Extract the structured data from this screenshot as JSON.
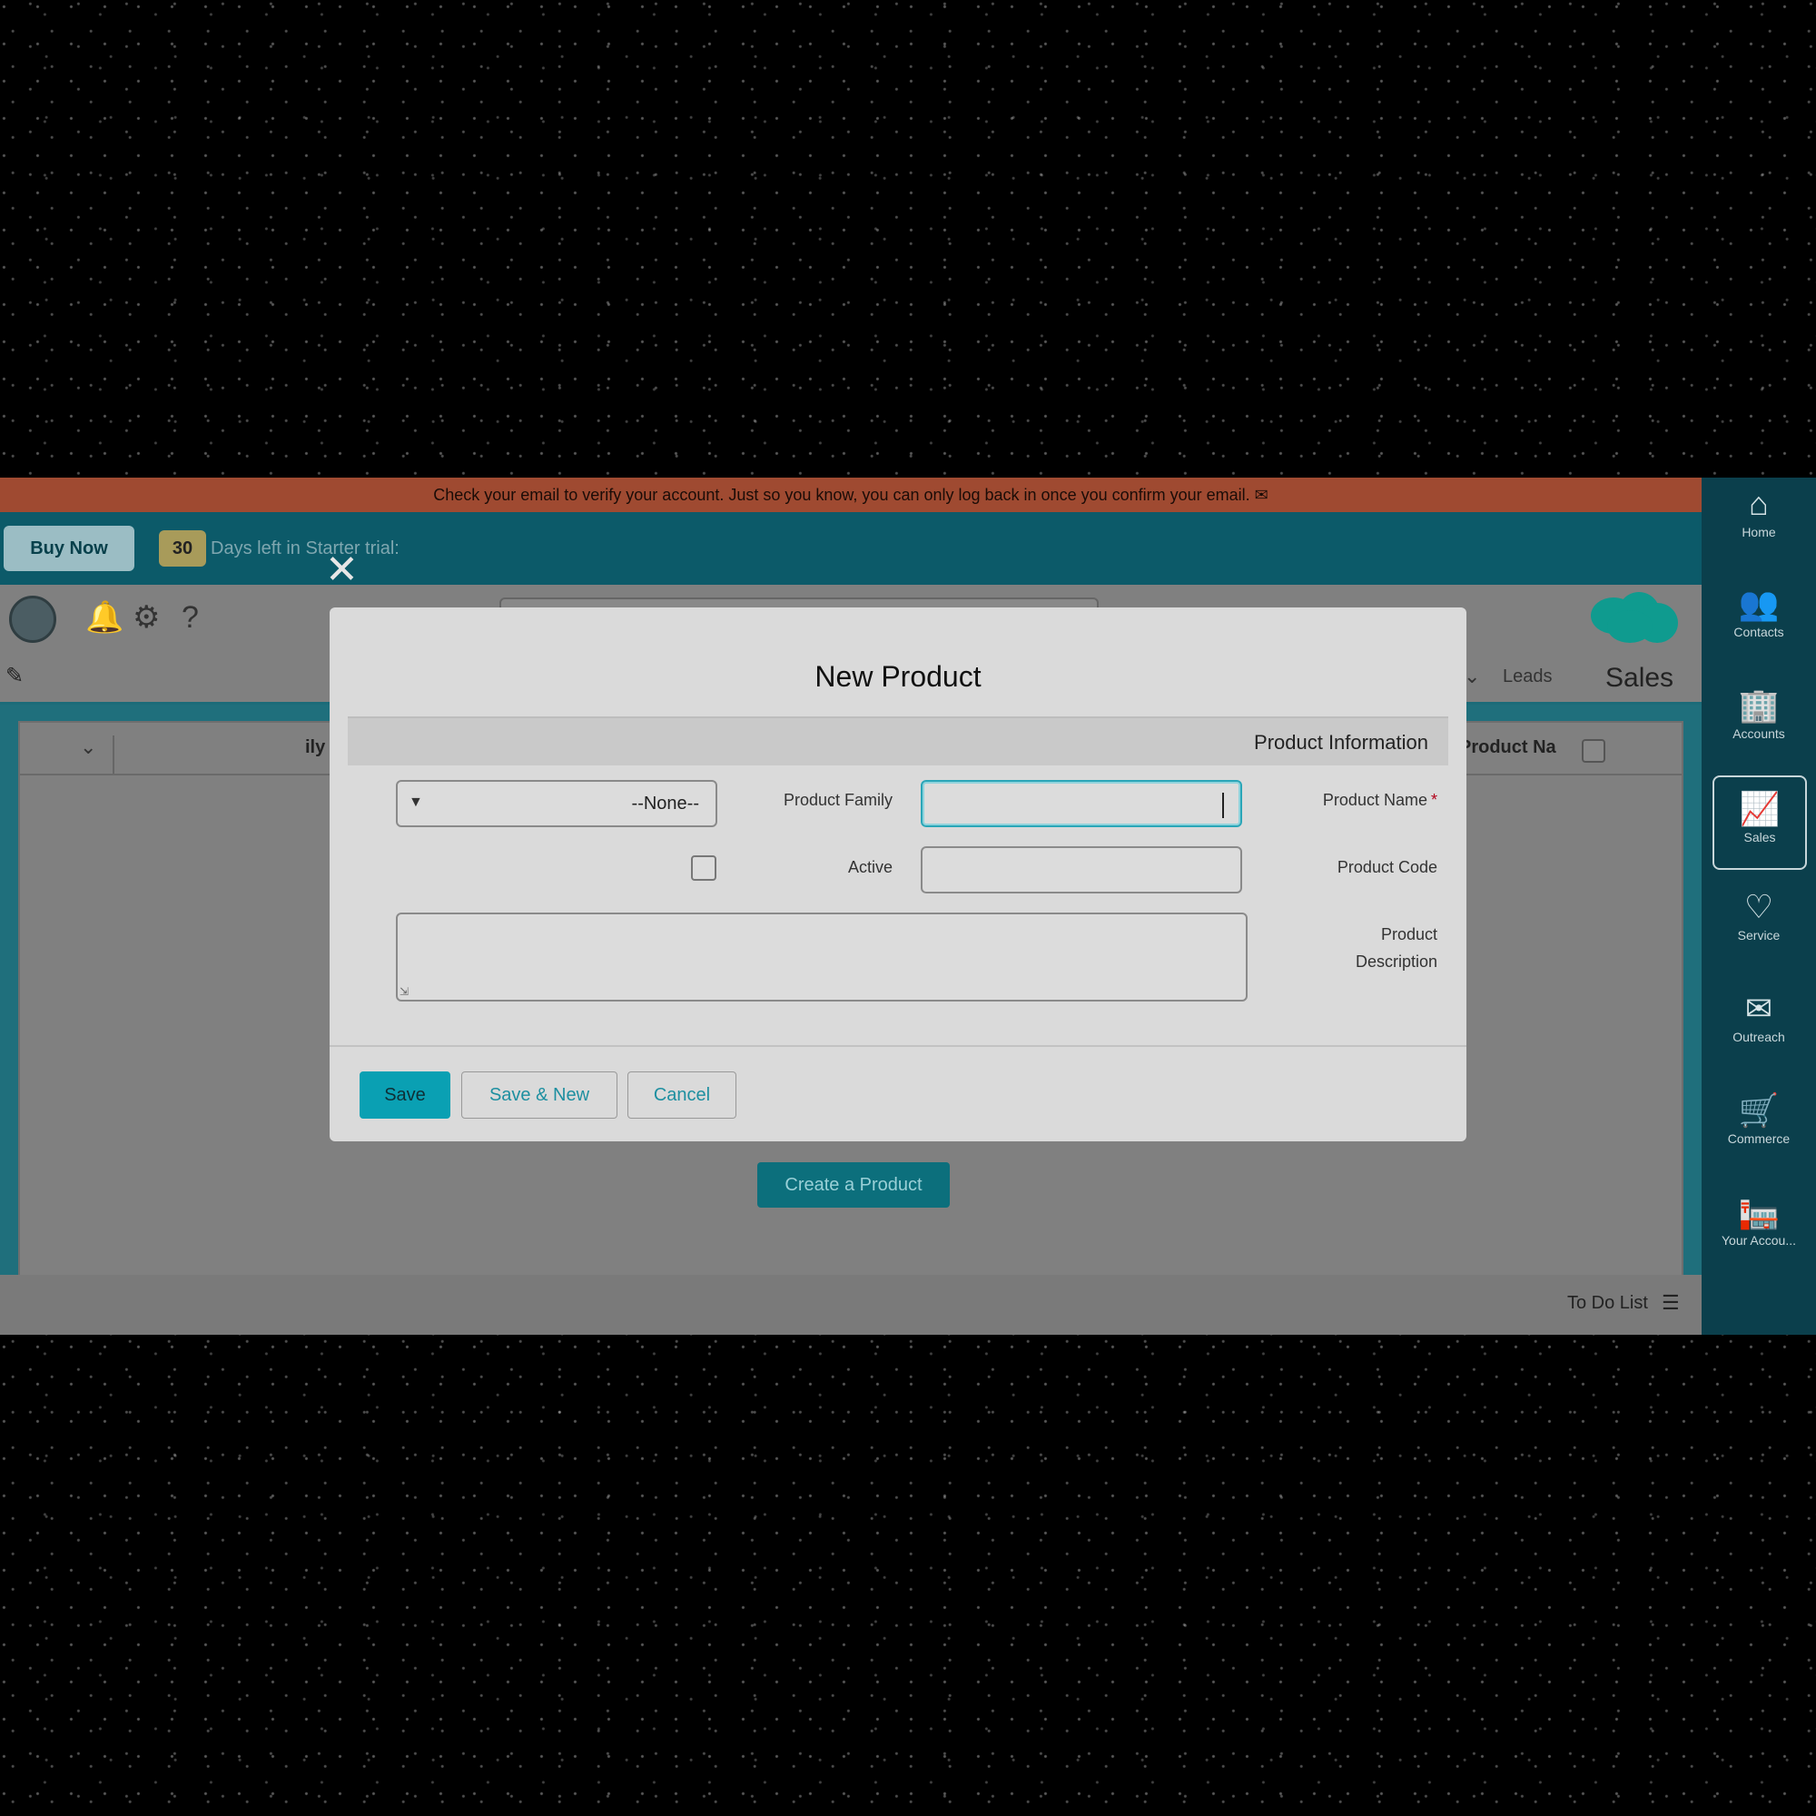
{
  "alert": {
    "icon": "envelope-icon",
    "text": "Check your email to verify your account. Just so you know, you can only log back in once you confirm your email."
  },
  "trial": {
    "label": "Days left in Starter trial:",
    "days": "30",
    "buy_label": "Buy Now"
  },
  "header": {
    "icons": [
      "help-icon",
      "gear-icon",
      "bell-icon"
    ]
  },
  "tabbar": {
    "app_title": "Sales",
    "tab_leads": "Leads"
  },
  "list": {
    "col_product_name": "Product Na",
    "col_family_fragment": "ily"
  },
  "create_product_label": "Create a Product",
  "footer": {
    "todo_label": "To Do List"
  },
  "rail": {
    "items": [
      {
        "label": "Home",
        "icon": "home-icon"
      },
      {
        "label": "Contacts",
        "icon": "contacts-icon"
      },
      {
        "label": "Accounts",
        "icon": "accounts-icon"
      },
      {
        "label": "Sales",
        "icon": "sales-icon",
        "active": true
      },
      {
        "label": "Service",
        "icon": "heart-icon"
      },
      {
        "label": "Outreach",
        "icon": "envelope-icon"
      },
      {
        "label": "Commerce",
        "icon": "cart-icon"
      },
      {
        "label": "Your Accou...",
        "icon": "building-icon"
      }
    ]
  },
  "modal": {
    "title": "New Product",
    "section_title": "Product Information",
    "fields": {
      "product_name": {
        "label": "Product Name",
        "required": "*",
        "value": ""
      },
      "product_code": {
        "label": "Product Code",
        "value": ""
      },
      "product_family": {
        "label": "Product Family",
        "value": "--None--"
      },
      "active": {
        "label": "Active",
        "checked": false
      },
      "product_description": {
        "label_line1": "Product",
        "label_line2": "Description",
        "value": ""
      }
    },
    "buttons": {
      "save": "Save",
      "save_new": "Save & New",
      "cancel": "Cancel"
    }
  },
  "colors": {
    "accent": "#0aa0b3",
    "alert_bg": "#9f4a31",
    "trial_bg": "#0c5a69",
    "rail_bg": "#0b3f4c",
    "required": "#b2001a"
  }
}
